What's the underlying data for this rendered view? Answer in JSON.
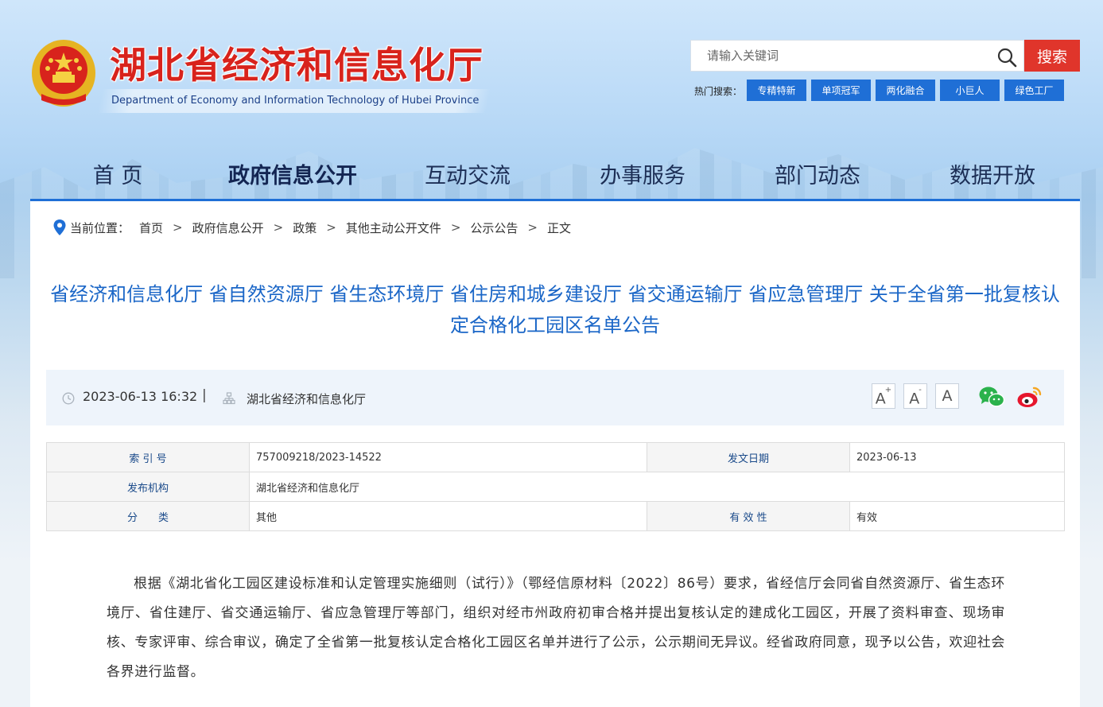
{
  "header": {
    "site_title": "湖北省经济和信息化厅",
    "site_subtitle": "Department of Economy and Information Technology of Hubei Province",
    "search": {
      "placeholder": "请输入关键词",
      "button_label": "搜索"
    },
    "hot_label": "热门搜索：",
    "hot_tags": [
      "专精特新",
      "单项冠军",
      "两化融合",
      "小巨人",
      "绿色工厂"
    ]
  },
  "nav": {
    "items": [
      "首 页",
      "政府信息公开",
      "互动交流",
      "办事服务",
      "部门动态",
      "数据开放"
    ]
  },
  "breadcrumb": {
    "label": "当前位置：",
    "items": [
      "首页",
      "政府信息公开",
      "政策",
      "其他主动公开文件",
      "公示公告",
      "正文"
    ],
    "sep": ">"
  },
  "article": {
    "title": "省经济和信息化厅 省自然资源厅 省生态环境厅 省住房和城乡建设厅 省交通运输厅 省应急管理厅 关于全省第一批复核认定合格化工园区名单公告",
    "date": "2023-06-13 16:32",
    "divider": "|",
    "org": "湖北省经济和信息化厅",
    "font_buttons": [
      "A",
      "A",
      "A"
    ],
    "font_buttons_sup": [
      "+",
      "-"
    ],
    "share": [
      "wechat-icon",
      "weibo-icon"
    ],
    "body": "根据《湖北省化工园区建设标准和认定管理实施细则（试行）》（鄂经信原材料〔2022〕86号）要求，省经信厅会同省自然资源厅、省生态环境厅、省住建厅、省交通运输厅、省应急管理厅等部门，组织对经市州政府初审合格并提出复核认定的建成化工园区，开展了资料审查、现场审核、专家评审、综合审议，确定了全省第一批复核认定合格化工园区名单并进行了公示，公示期间无异议。经省政府同意，现予以公告，欢迎社会各界进行监督。"
  },
  "info_table": {
    "index_label": "索 引 号",
    "index_value": "757009218/2023-14522",
    "issue_date_label": "发文日期",
    "issue_date_value": "2023-06-13",
    "publisher_label": "发布机构",
    "publisher_value": "湖北省经济和信息化厅",
    "category_label": "分　　类",
    "category_value": "其他",
    "validity_label": "有 效 性",
    "validity_value": "有效"
  },
  "colors": {
    "brand_red": "#d8231c",
    "accent_blue": "#1f6fd6",
    "title_blue": "#1a66c7",
    "search_red": "#e0352b"
  }
}
